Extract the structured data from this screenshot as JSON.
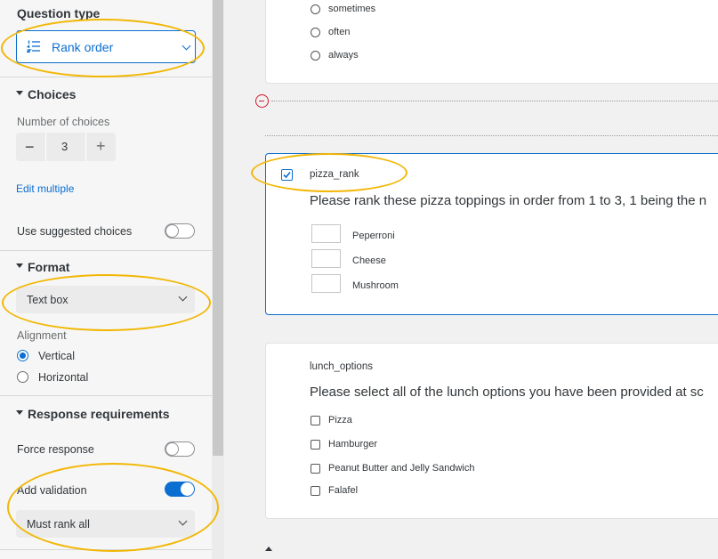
{
  "sidebar": {
    "question_type": {
      "heading": "Question type",
      "value": "Rank order"
    },
    "choices": {
      "heading": "Choices",
      "number_label": "Number of choices",
      "minus": "−",
      "count": "3",
      "plus": "+",
      "edit_multiple": "Edit multiple",
      "suggested_label": "Use suggested choices",
      "suggested_on": false
    },
    "format": {
      "heading": "Format",
      "value": "Text box",
      "alignment_label": "Alignment",
      "options": [
        {
          "label": "Vertical",
          "selected": true
        },
        {
          "label": "Horizontal",
          "selected": false
        }
      ]
    },
    "response": {
      "heading": "Response requirements",
      "force_label": "Force response",
      "force_on": false,
      "validation_label": "Add validation",
      "validation_on": true,
      "validation_value": "Must rank all"
    }
  },
  "survey": {
    "prev_options": [
      "sometimes",
      "often",
      "always"
    ],
    "rank_question": {
      "id": "pizza_rank",
      "text": "Please rank these pizza toppings in order from 1 to 3, 1 being the n",
      "items": [
        "Peperroni",
        "Cheese",
        "Mushroom"
      ]
    },
    "lunch_question": {
      "id": "lunch_options",
      "text": "Please select all of the lunch options you have been provided at sc",
      "items": [
        "Pizza",
        "Hamburger",
        "Peanut Butter and Jelly Sandwich",
        "Falafel"
      ]
    }
  },
  "colors": {
    "accent": "#0b6ed0",
    "highlight": "#f2b705",
    "remove": "#d6182f"
  }
}
